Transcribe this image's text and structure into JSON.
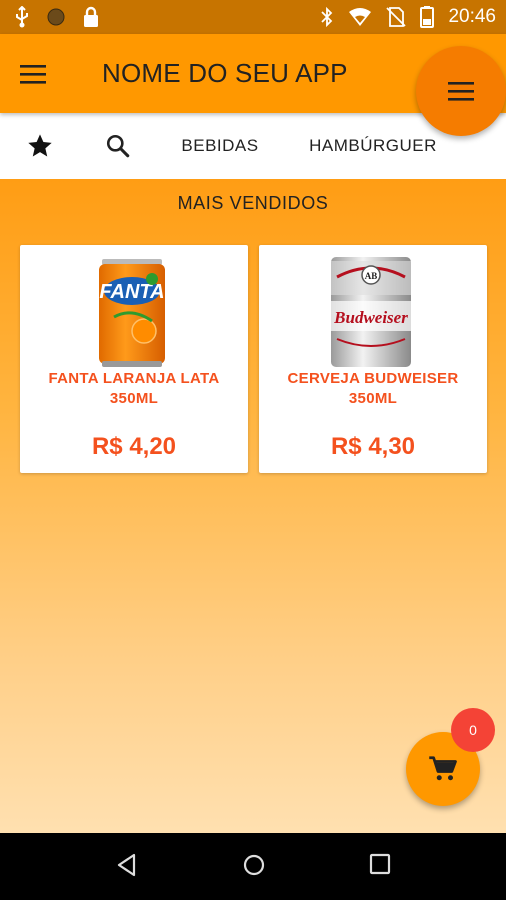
{
  "status_bar": {
    "time": "20:46",
    "left_icons": [
      "usb-icon",
      "circle-icon",
      "lock-icon"
    ],
    "right_icons": [
      "bluetooth-icon",
      "wifi-icon",
      "no-sim-icon",
      "battery-icon"
    ]
  },
  "app_bar": {
    "title": "NOME DO SEU APP",
    "menu_icon": "menu-icon",
    "fab_icon": "menu-icon"
  },
  "tabs": [
    {
      "icon": "star-icon",
      "label": ""
    },
    {
      "icon": "search-icon",
      "label": ""
    },
    {
      "label": "BEBIDAS"
    },
    {
      "label": "HAMBÚRGUER"
    }
  ],
  "section": {
    "title": "MAIS VENDIDOS"
  },
  "products": [
    {
      "name_line1": "FANTA LARANJA LATA",
      "name_line2": "350ML",
      "price": "R$ 4,20",
      "image": "fanta-can"
    },
    {
      "name_line1": "CERVEJA BUDWEISER",
      "name_line2": "350ML",
      "price": "R$ 4,30",
      "image": "budweiser-can"
    }
  ],
  "cart": {
    "count": "0",
    "icon": "cart-icon"
  },
  "nav": [
    "back-icon",
    "home-icon",
    "recents-icon"
  ],
  "colors": {
    "primary": "#ff9800",
    "status_bar": "#c77400",
    "accent_text": "#f4511e",
    "badge": "#f44336"
  }
}
